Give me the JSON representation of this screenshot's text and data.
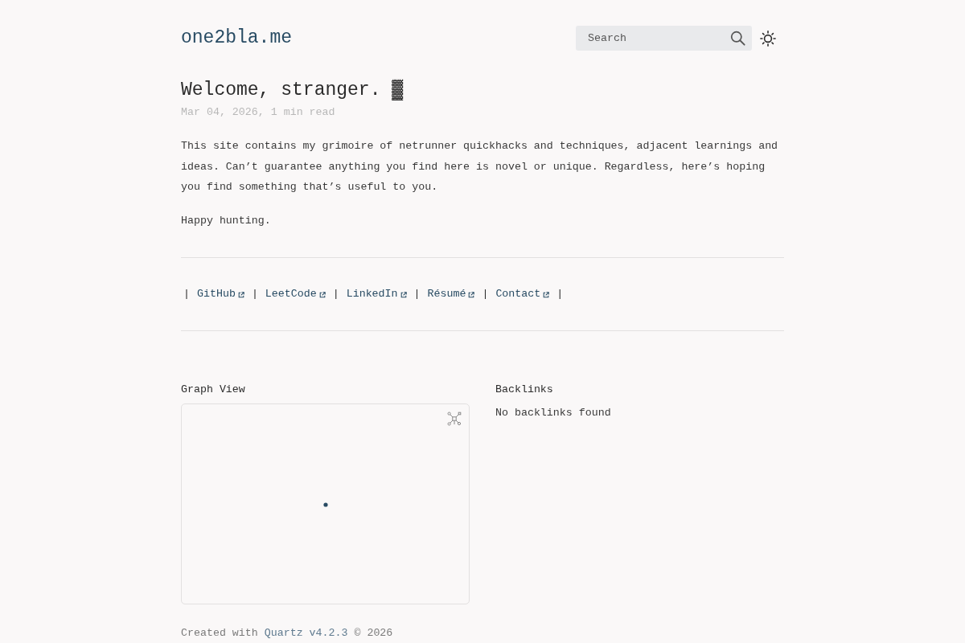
{
  "header": {
    "site_title": "one2bla.me",
    "search": {
      "placeholder": "Search"
    }
  },
  "article": {
    "title": "Welcome, stranger. ▓",
    "meta": "Mar 04, 2026, 1 min read",
    "paragraphs": [
      "This site contains my grimoire of netrunner quickhacks and techniques, adjacent learnings and ideas. Can’t guarantee anything you find here is novel or unique. Regardless, here’s hoping you find something that’s useful to you.",
      "Happy hunting."
    ]
  },
  "links_row": [
    {
      "kind": "separator",
      "text": "|"
    },
    {
      "kind": "link",
      "label": "GitHub"
    },
    {
      "kind": "separator",
      "text": "|"
    },
    {
      "kind": "link",
      "label": "LeetCode"
    },
    {
      "kind": "separator",
      "text": "|"
    },
    {
      "kind": "link",
      "label": "LinkedIn"
    },
    {
      "kind": "separator",
      "text": "|"
    },
    {
      "kind": "link",
      "label": "Résumé"
    },
    {
      "kind": "separator",
      "text": "|"
    },
    {
      "kind": "link",
      "label": "Contact"
    },
    {
      "kind": "separator",
      "text": "|"
    }
  ],
  "graph_view": {
    "title": "Graph View"
  },
  "backlinks": {
    "title": "Backlinks",
    "empty_message": "No backlinks found"
  },
  "footer": {
    "prefix": "Created with",
    "link": "Quartz v4.2.3",
    "suffix": "© 2026"
  }
}
